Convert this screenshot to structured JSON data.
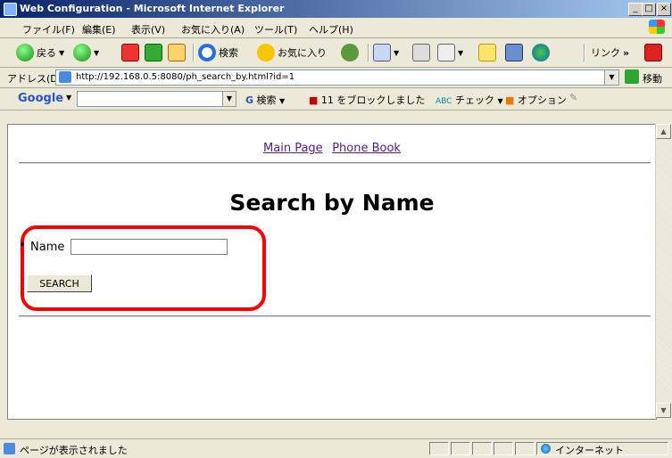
{
  "window": {
    "title": "Web Configuration - Microsoft Internet Explorer",
    "min_glyph": "_",
    "max_glyph": "□",
    "close_glyph": "×"
  },
  "menu": [
    {
      "label": "ファイル(F)"
    },
    {
      "label": "編集(E)"
    },
    {
      "label": "表示(V)"
    },
    {
      "label": "お気に入り(A)"
    },
    {
      "label": "ツール(T)"
    },
    {
      "label": "ヘルプ(H)"
    }
  ],
  "toolbar": {
    "back": "戻る",
    "search": "検索",
    "favorites": "お気に入り",
    "links": "リンク",
    "chevron": "»"
  },
  "address": {
    "label": "アドレス(D)",
    "url": "http://192.168.0.5:8080/ph_search_by.html?id=1",
    "go": "移動"
  },
  "google_bar": {
    "logo": "Google",
    "search": "検索",
    "blocked": "11 をブロックしました",
    "check": "チェック",
    "options": "オプション"
  },
  "page": {
    "nav": {
      "main_page": "Main Page",
      "phone_book": "Phone Book"
    },
    "heading": "Search by Name",
    "name_label": "Name",
    "name_value": "",
    "search_button": "SEARCH"
  },
  "status": {
    "text": "ページが表示されました",
    "zone": "インターネット"
  },
  "colors": {
    "title_gradient_start": "#0a246a",
    "title_gradient_end": "#a6caf0",
    "highlight": "#ff0000",
    "link": "#551a8b"
  }
}
